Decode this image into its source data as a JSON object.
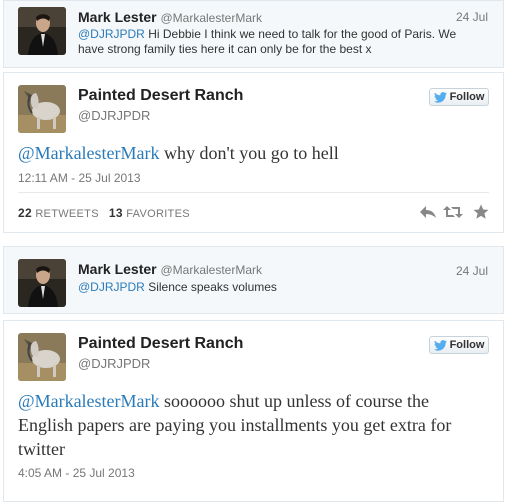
{
  "tweet1_parent": {
    "name": "Mark Lester",
    "handle": "@MarkalesterMark",
    "date": "24 Jul",
    "mention": "@DJRJPDR",
    "text": " Hi Debbie I think we need to talk for the good of Paris. We have strong family ties here it can only be for the best x"
  },
  "tweet1_main": {
    "name": "Painted Desert Ranch",
    "handle": "@DJRJPDR",
    "follow_label": "Follow",
    "mention": "@MarkalesterMark",
    "text": " why don't you go to hell",
    "timestamp": "12:11 AM - 25 Jul 2013",
    "retweets_count": "22",
    "retweets_label": "RETWEETS",
    "favorites_count": "13",
    "favorites_label": "FAVORITES"
  },
  "tweet2_parent": {
    "name": "Mark Lester",
    "handle": "@MarkalesterMark",
    "date": "24 Jul",
    "mention": "@DJRJPDR",
    "text": " Silence speaks volumes"
  },
  "tweet2_main": {
    "name": "Painted Desert Ranch",
    "handle": "@DJRJPDR",
    "follow_label": "Follow",
    "mention": "@MarkalesterMark",
    "text": " soooooo shut up unless of course the English papers are paying you installments you get extra for twitter",
    "timestamp": "4:05 AM - 25 Jul 2013"
  },
  "colors": {
    "link": "#2b7bb9",
    "twitter_bird": "#55acee"
  },
  "icons": [
    "reply-icon",
    "retweet-icon",
    "favorite-icon",
    "twitter-bird-icon"
  ]
}
